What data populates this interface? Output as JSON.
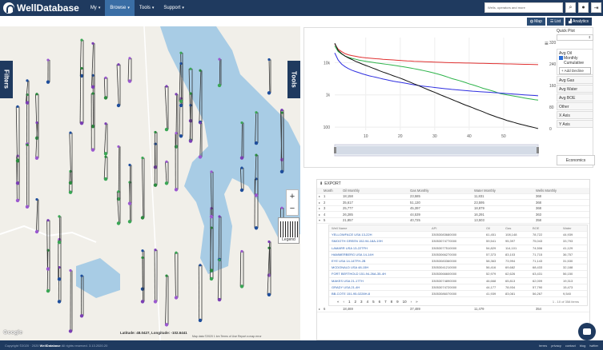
{
  "brand": {
    "name": "WellDatabase"
  },
  "nav": [
    {
      "label": "My"
    },
    {
      "label": "Browse",
      "active": true
    },
    {
      "label": "Tools"
    },
    {
      "label": "Support"
    }
  ],
  "search": {
    "placeholder": "Wells, operators and more"
  },
  "view_tabs": [
    {
      "label": "Map",
      "icon": "globe-icon"
    },
    {
      "label": "List",
      "icon": "list-icon"
    },
    {
      "label": "Analytics",
      "icon": "chart-icon",
      "active": true
    }
  ],
  "map": {
    "filters_label": "Filters",
    "tools_label": "Tools",
    "zoom_in": "+",
    "zoom_out": "−",
    "legend_label": "Legend",
    "latlon": "Latitude: 48.0427, Longitude: -102.6441",
    "attribution": "Map data ©2020   1 km   Terms of Use   Report a map error",
    "google": "Google"
  },
  "quick_plot": {
    "title": "Quick Plot",
    "items": [
      "Avg Oil",
      "Avg Gas",
      "Avg Water",
      "Avg BOE",
      "Other",
      "X Axis",
      "Y Axis"
    ],
    "monthly_cumulative": "Monthly",
    "cumulative": "Cumulative",
    "add_decline": "+ Add Decline",
    "economics": "Economics"
  },
  "chart_data": {
    "type": "line",
    "x": [
      1,
      2,
      3,
      4,
      5,
      6,
      7,
      8,
      9,
      10,
      11,
      12,
      13,
      14,
      15,
      16,
      17,
      18,
      19,
      20,
      21,
      22,
      23,
      24,
      25,
      26,
      27,
      28,
      29,
      30,
      31,
      32,
      33,
      34,
      35,
      36,
      37,
      38,
      39,
      40,
      41,
      42,
      43,
      44,
      45,
      46,
      47,
      48,
      49,
      50,
      51,
      52,
      53,
      54,
      55,
      56,
      57,
      58,
      59,
      60
    ],
    "xticks": [
      "10",
      "20",
      "30",
      "40",
      "50"
    ],
    "yticks_left": [
      "10k",
      "1k",
      "100"
    ],
    "yticks_right": [
      "320",
      "240",
      "160",
      "80",
      "0"
    ],
    "series": [
      {
        "color": "#e03030",
        "values": [
          38000,
          26000,
          22000,
          19000,
          17500,
          16500,
          15800,
          15000,
          14500,
          14100,
          13800,
          13500,
          13200,
          13000,
          12700,
          12500,
          12300,
          12100,
          11900,
          11700,
          11500,
          11300,
          11200,
          11000,
          10900,
          10800,
          10700,
          10600,
          10500,
          10400,
          10300,
          10200,
          10100,
          10000,
          9950,
          9900,
          9850,
          9800,
          9750,
          9700,
          9650,
          9600,
          9550,
          9500,
          9450,
          9400,
          9350,
          9300,
          9250,
          9200,
          9150,
          9100,
          9050,
          9000,
          8950,
          8900,
          8850,
          8800,
          8750,
          8700
        ]
      },
      {
        "color": "#2db34a",
        "values": [
          33000,
          22000,
          18500,
          16000,
          14500,
          13500,
          12800,
          12000,
          11500,
          11000,
          10600,
          10200,
          9800,
          9500,
          9200,
          8900,
          8600,
          8300,
          8000,
          7700,
          7400,
          7100,
          6800,
          6500,
          6200,
          5900,
          5600,
          5300,
          5000,
          4700,
          4400,
          4100,
          3800,
          3500,
          3200,
          3000,
          2800,
          2600,
          2400,
          2200,
          2050,
          1900,
          1750,
          1600,
          1500,
          1400,
          1300,
          1200,
          1100,
          1050,
          1000,
          960,
          920,
          880,
          840,
          800,
          770,
          740,
          710,
          690
        ]
      },
      {
        "color": "#2e2ee0",
        "values": [
          20000,
          12000,
          9000,
          7500,
          6500,
          5800,
          5300,
          4900,
          4500,
          4200,
          3900,
          3700,
          3500,
          3300,
          3100,
          2950,
          2800,
          2650,
          2550,
          2450,
          2350,
          2250,
          2150,
          2050,
          1980,
          1900,
          1850,
          1800,
          1750,
          1700,
          1650,
          1600,
          1560,
          1520,
          1480,
          1450,
          1420,
          1390,
          1360,
          1330,
          1300,
          1280,
          1260,
          1240,
          1220,
          1200,
          1180,
          1160,
          1140,
          1120,
          1100,
          1080,
          1060,
          1040,
          1020,
          1000,
          985,
          970,
          955,
          940
        ]
      },
      {
        "color": "#111111",
        "values": [
          40000,
          24000,
          19000,
          16000,
          14000,
          12500,
          11000,
          10000,
          9000,
          8200,
          7500,
          6800,
          6200,
          5600,
          5100,
          4700,
          4300,
          3900,
          3600,
          3300,
          3000,
          2700,
          2450,
          2200,
          2000,
          1800,
          1620,
          1460,
          1320,
          1200,
          1080,
          970,
          880,
          800,
          720,
          650,
          590,
          530,
          480,
          440,
          400,
          360,
          330,
          300,
          270,
          245,
          225,
          205,
          190,
          175,
          160,
          150,
          140,
          130,
          122,
          115,
          108,
          102,
          96,
          90
        ]
      }
    ]
  },
  "grid": {
    "export_label": "EXPORT",
    "headers": {
      "month": "Month",
      "oil": "Oil Monthly",
      "gas": "Gas Monthly",
      "water": "Water Monthly",
      "wells": "Wells Monthly"
    },
    "rows": [
      {
        "month": "1",
        "oil": "18,158",
        "gas": "23,585",
        "water": "11,831",
        "wells": "368"
      },
      {
        "month": "2",
        "oil": "35,617",
        "gas": "51,130",
        "water": "23,595",
        "wells": "368"
      },
      {
        "month": "3",
        "oil": "25,777",
        "gas": "45,397",
        "water": "18,879",
        "wells": "368"
      },
      {
        "month": "4",
        "oil": "26,285",
        "gas": "44,539",
        "water": "16,291",
        "wells": "363"
      },
      {
        "month": "5",
        "oil": "21,857",
        "gas": "40,725",
        "water": "13,503",
        "wells": "358"
      }
    ],
    "sub_headers": {
      "name": "Well Name",
      "api": "API",
      "oil": "Oil",
      "gas": "Gas",
      "boe": "BOE",
      "water": "Water"
    },
    "sub_rows": [
      {
        "name": "YELLOWFACE USA 13-22H",
        "api": "33053083680000",
        "oil": "61,451",
        "gas": "108,148",
        "boe": "78,722",
        "water": "44,939"
      },
      {
        "name": "SMOOTH GREEN 152-94-18A-19H",
        "api": "33053074770000",
        "oil": "59,541",
        "gas": "95,397",
        "boe": "75,043",
        "water": "33,793"
      },
      {
        "name": "LAMARR USA 13-22TFH",
        "api": "33053077510000",
        "oil": "54,829",
        "gas": "114,101",
        "boe": "74,506",
        "water": "41,129"
      },
      {
        "name": "HAMMERBERG USA 14-14H",
        "api": "33053066270000",
        "oil": "57,373",
        "gas": "83,103",
        "boe": "71,715",
        "water": "36,757"
      },
      {
        "name": "EYE USA 14-14TFH-2B",
        "api": "33053083360000",
        "oil": "58,363",
        "gas": "73,994",
        "boe": "71,143",
        "water": "31,530"
      },
      {
        "name": "MCDONALD USA 48-15H",
        "api": "33053041210000",
        "oil": "56,416",
        "gas": "69,682",
        "boe": "68,433",
        "water": "32,188"
      },
      {
        "name": "FORT BERTHOLD 151-94-26A-35-4H",
        "api": "33053066600000",
        "oil": "52,979",
        "gas": "62,626",
        "boe": "63,431",
        "water": "56,150"
      },
      {
        "name": "MAKES USA 21-17TH",
        "api": "33053074890000",
        "oil": "46,668",
        "gas": "65,813",
        "boe": "62,009",
        "water": "19,313"
      },
      {
        "name": "GRADY USA 21-4H",
        "api": "33053074720000",
        "oil": "44,177",
        "gas": "78,934",
        "boe": "57,790",
        "water": "15,473"
      },
      {
        "name": "BB-COTE 151-95-0228H-8",
        "api": "33053086070000",
        "oil": "41,939",
        "gas": "83,081",
        "boe": "56,267",
        "water": "9,540"
      }
    ],
    "pager": {
      "pages": [
        "«",
        "‹",
        "1",
        "2",
        "3",
        "4",
        "5",
        "6",
        "7",
        "8",
        "9",
        "10",
        "›",
        "»"
      ],
      "info": "1 - 10 of 358 items"
    },
    "row6": {
      "month": "6",
      "oil": "18,469",
      "gas": "37,489",
      "water": "11,479",
      "wells": "354"
    }
  },
  "footer": {
    "copyright": "Copyright ©2020 · 2020",
    "brand": "WellDatabase",
    "rights": "All rights reserved. 3.13.2020.20",
    "links": [
      "terms",
      "privacy",
      "contact",
      "blog",
      "twitter"
    ]
  }
}
